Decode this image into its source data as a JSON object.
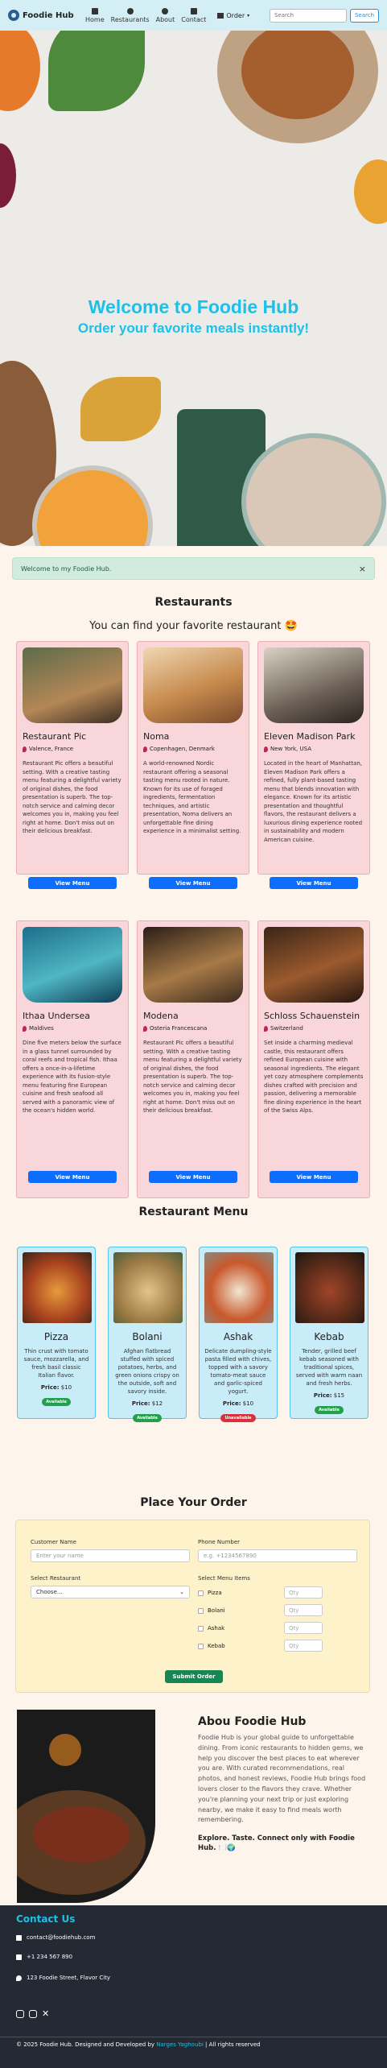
{
  "nav": {
    "brand": "Foodie Hub",
    "items": [
      {
        "label": "Home",
        "icon": "home-icon"
      },
      {
        "label": "Restaurants",
        "icon": "restaurant-icon"
      },
      {
        "label": "About",
        "icon": "info-icon"
      },
      {
        "label": "Contact",
        "icon": "mail-icon"
      }
    ],
    "order_label": "Order",
    "search_placeholder": "Search",
    "search_button": "Search"
  },
  "hero": {
    "title": "Welcome to Foodie Hub",
    "subtitle": "Order your favorite meals instantly!"
  },
  "alert": {
    "text": "Welcome to my Foodie Hub.",
    "close": "×"
  },
  "restaurants": {
    "title": "Restaurants",
    "subtitle": "You can find your favorite restaurant 🤩",
    "view_label": "View Menu",
    "items": [
      {
        "name": "Restaurant Pic",
        "location": "Valence, France",
        "desc": "Restaurant Pic offers a beautiful setting. With a creative tasting menu featuring a delightful variety of original dishes, the food presentation is superb. The top-notch service and calming decor welcomes you in, making you feel right at home. Don't miss out on their delicious breakfast."
      },
      {
        "name": "Noma",
        "location": "Copenhagen, Denmark",
        "desc": "A world-renowned Nordic restaurant offering a seasonal tasting menu rooted in nature. Known for its use of foraged ingredients, fermentation techniques, and artistic presentation, Noma delivers an unforgettable fine dining experience in a minimalist setting."
      },
      {
        "name": "Eleven Madison Park",
        "location": "New York, USA",
        "desc": "Located in the heart of Manhattan, Eleven Madison Park offers a refined, fully plant-based tasting menu that blends innovation with elegance. Known for its artistic presentation and thoughtful flavors, the restaurant delivers a luxurious dining experience rooted in sustainability and modern American cuisine."
      },
      {
        "name": "Ithaa Undersea",
        "location": "Maldives",
        "desc": "Dine five meters below the surface in a glass tunnel surrounded by coral reefs and tropical fish. Ithaa offers a once-in-a-lifetime experience with its fusion-style menu featuring fine European cuisine and fresh seafood all served with a panoramic view of the ocean's hidden world."
      },
      {
        "name": "Modena",
        "location": "Osteria Francescana",
        "desc": "Restaurant Pic offers a beautiful setting. With a creative tasting menu featuring a delightful variety of original dishes, the food presentation is superb. The top-notch service and calming decor welcomes you in, making you feel right at home. Don't miss out on their delicious breakfast."
      },
      {
        "name": "Schloss Schauenstein",
        "location": "Switzerland",
        "desc": "Set inside a charming medieval castle, this restaurant offers refined European cuisine with seasonal ingredients. The elegant yet cozy atmosphere complements dishes crafted with precision and passion, delivering a memorable fine dining experience in the heart of the Swiss Alps."
      }
    ]
  },
  "menu": {
    "title": "Restaurant Menu",
    "price_label": "Price:",
    "items": [
      {
        "name": "Pizza",
        "desc": "Thin crust with tomato sauce, mozzarella, and fresh basil classic Italian flavor.",
        "price": "$10",
        "status": "Available",
        "status_color": "#22a04b"
      },
      {
        "name": "Bolani",
        "desc": "Afghan flatbread stuffed with spiced potatoes, herbs, and green onions crispy on the outside, soft and savory inside.",
        "price": "$12",
        "status": "Available",
        "status_color": "#22a04b"
      },
      {
        "name": "Ashak",
        "desc": "Delicate dumpling-style pasta filled with chives, topped with a savory tomato-meat sauce and garlic-spiced yogurt.",
        "price": "$10",
        "status": "Unavailable",
        "status_color": "#d9303d"
      },
      {
        "name": "Kebab",
        "desc": "Tender, grilled beef kebab seasoned with traditional spices, served with warm naan and fresh herbs.",
        "price": "$15",
        "status": "Available",
        "status_color": "#22a04b"
      }
    ]
  },
  "order": {
    "title": "Place Your Order",
    "customer_label": "Customer Name",
    "customer_placeholder": "Enter your name",
    "phone_label": "Phone Number",
    "phone_placeholder": "e.g. +1234567890",
    "restaurant_label": "Select Restaurant",
    "restaurant_value": "Choose...",
    "items_label": "Select Menu Items",
    "qty_placeholder": "Qty",
    "menu_items": [
      "Pizza",
      "Bolani",
      "Ashak",
      "Kebab"
    ],
    "submit": "Submit Order"
  },
  "about": {
    "title": "Abou Foodie Hub",
    "text": "Foodie Hub is your global guide to unforgettable dining. From iconic restaurants to hidden gems, we help you discover the best places to eat wherever you are. With curated recommendations, real photos, and honest reviews, Foodie Hub brings food lovers closer to the flavors they crave. Whether you're planning your next trip or just exploring nearby, we make it easy to find meals worth remembering.",
    "tagline": "Explore. Taste. Connect only with Foodie Hub. 🍽️🌍"
  },
  "footer": {
    "title": "Contact Us",
    "email": "contact@foodiehub.com",
    "phone": "+1 234 567 890",
    "address": "123 Foodie Street, Flavor City",
    "copyright": "© 2025 Foodie Hub. Designed and Developed by",
    "author": "Narges Yaghoubi",
    "rights": "| All rights reserved"
  },
  "colors": {
    "accent": "#1cc0e8",
    "primary_button": "#0d6efd",
    "submit": "#188653"
  }
}
